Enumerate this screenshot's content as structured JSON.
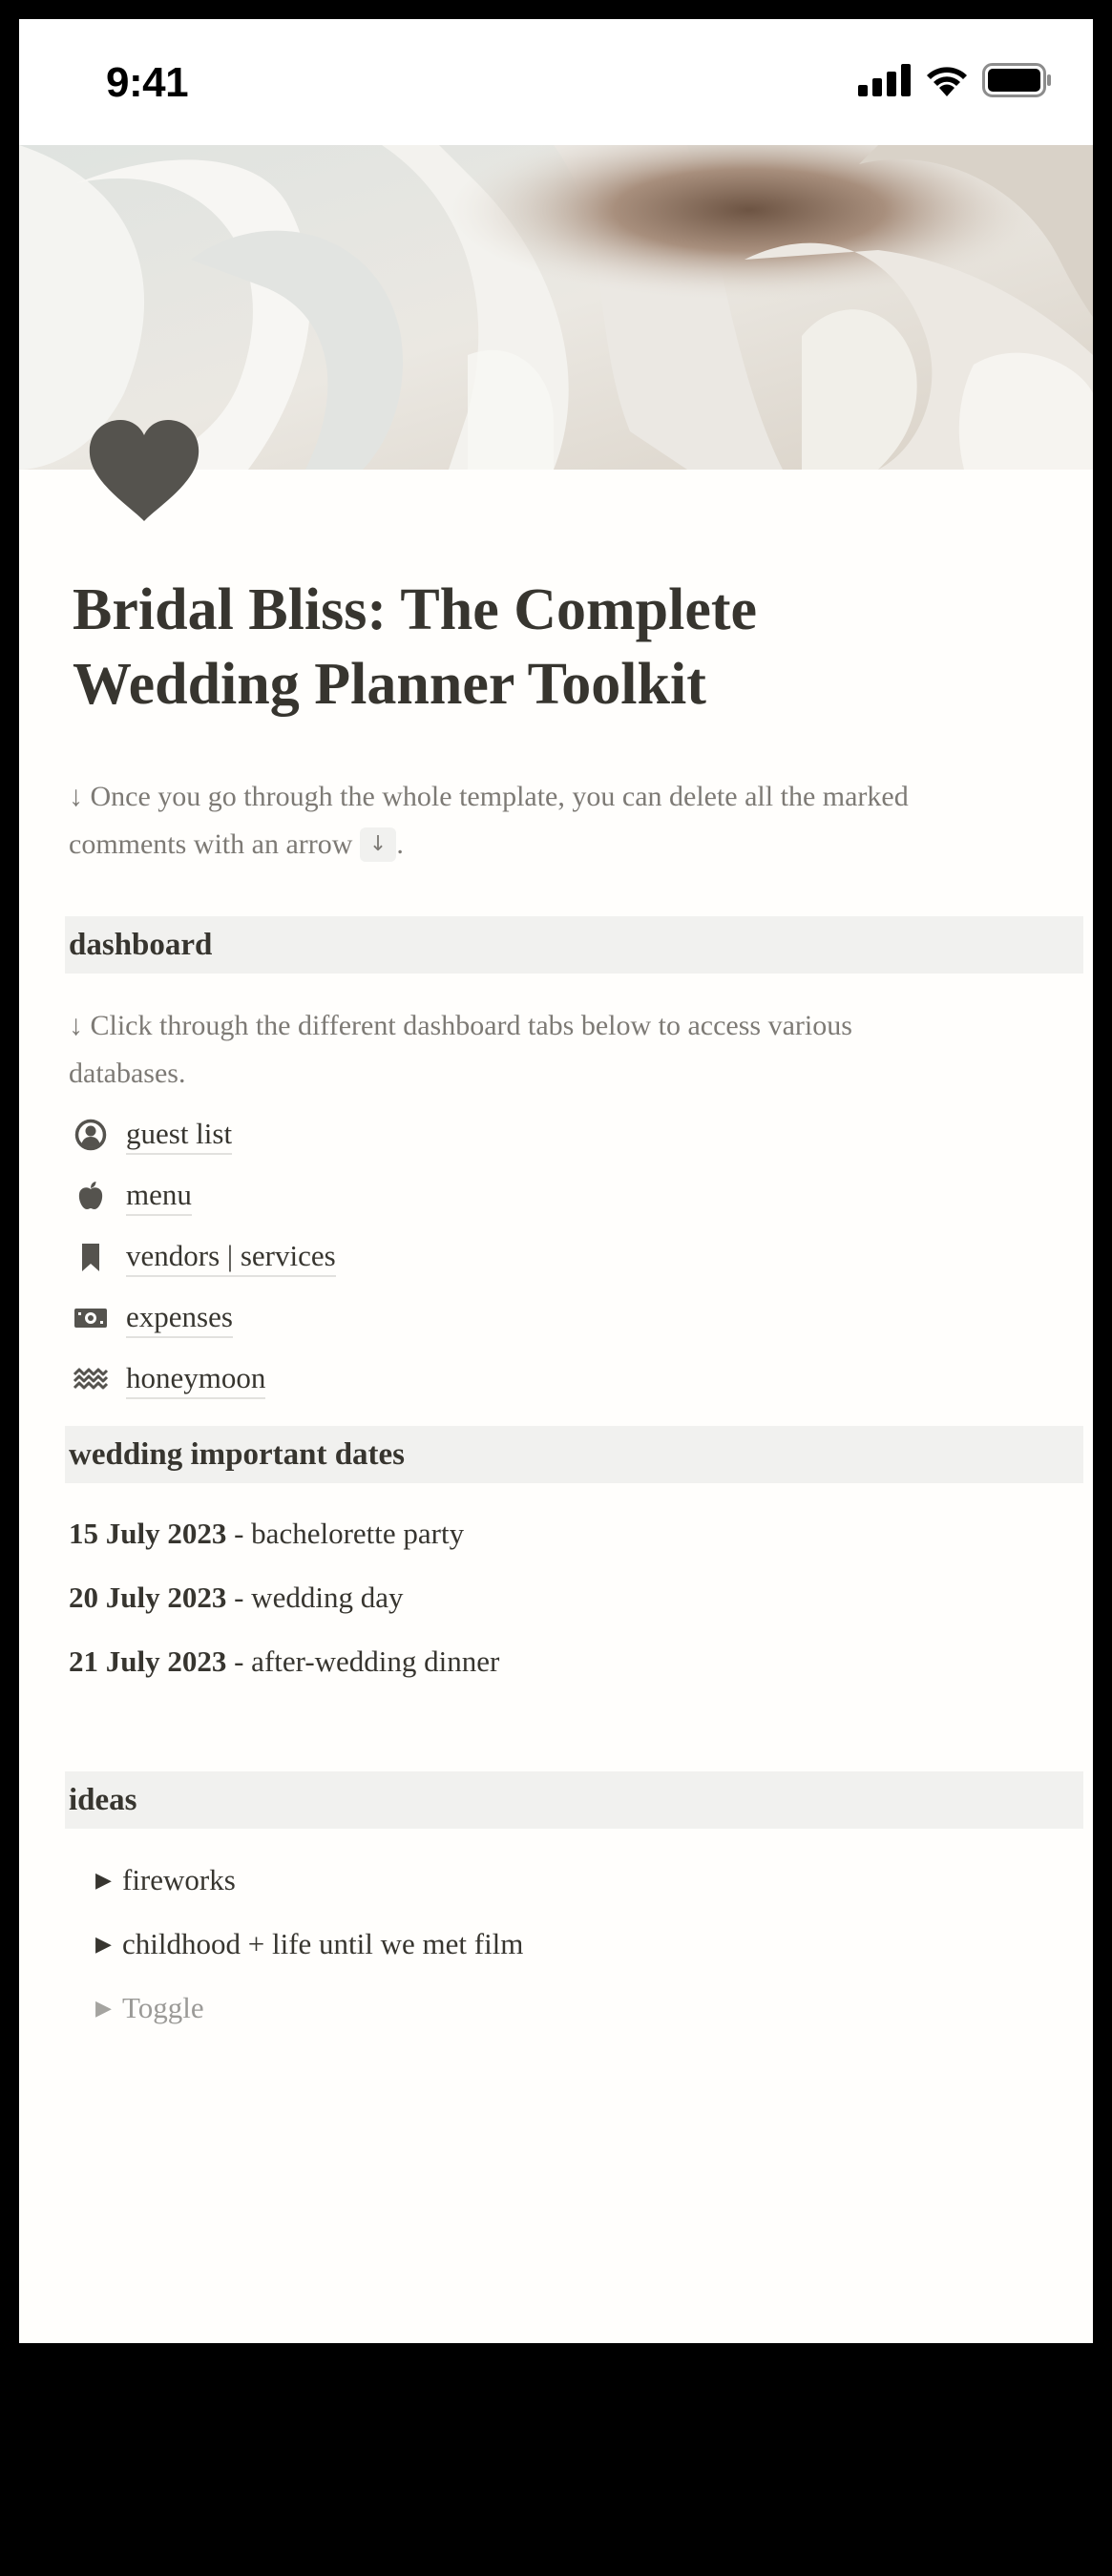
{
  "status_bar": {
    "time": "9:41"
  },
  "page": {
    "title_line1": "Bridal Bliss: The Complete",
    "title_line2": "Wedding Planner Toolkit",
    "intro_note_line1": "↓ Once you go through the whole template, you can delete all the marked",
    "intro_note_line2": "comments with an arrow",
    "intro_note_code": "↓",
    "intro_note_end": "."
  },
  "dashboard": {
    "header": "dashboard",
    "note_line1": "↓ Click through the different dashboard tabs below to access various",
    "note_line2": "databases.",
    "links": [
      {
        "label": "guest list",
        "icon": "user-circle-icon"
      },
      {
        "label": "menu",
        "icon": "apple-icon"
      },
      {
        "label": "vendors | services",
        "icon": "bookmark-icon"
      },
      {
        "label": "expenses",
        "icon": "money-icon"
      },
      {
        "label": "honeymoon",
        "icon": "waves-icon"
      }
    ]
  },
  "dates": {
    "header": "wedding important dates",
    "items": [
      {
        "date": "15 July 2023",
        "event": " - bachelorette party"
      },
      {
        "date": "20 July 2023",
        "event": " - wedding day"
      },
      {
        "date": "21 July 2023",
        "event": " - after-wedding dinner"
      }
    ]
  },
  "ideas": {
    "header": "ideas",
    "toggles": [
      {
        "label": "fireworks"
      },
      {
        "label": "childhood + life until we met film"
      }
    ],
    "placeholder": "Toggle"
  },
  "colors": {
    "text": "#37352f",
    "muted": "#7d7a75",
    "header_bg": "#f1f1ef",
    "icon": "#55534e"
  }
}
